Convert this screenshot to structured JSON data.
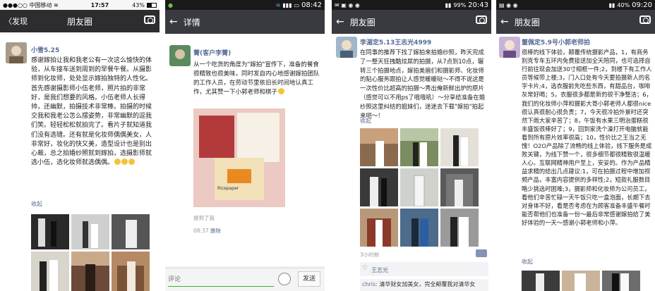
{
  "panels": {
    "p1": {
      "status": {
        "carrier": "中国移动",
        "time": "17:57",
        "battery": "43%"
      },
      "back": "发现",
      "title": "朋友圈",
      "name": "小雪5.25",
      "text": "感谢嫁拍让我和我老公有一次这么愉快的体验，从车接车送到周到的早餐午餐。从摄影师到化妆师，处处显示嫁拍独特的人性化。首先感谢摄影师小伍老师，照片拍的非常好，是我们想要的风格。小伍老师人长得帅，还幽默，拍摄技术非常棒。拍摄的时候交我和我老公怎么摆姿势，非常幽默的逗我们笑。轻轻松松就拍完了。看片子就知道我们没有选错。还有就是化妆师偶偶美女，人非常好，妆化的快又美，造型设计也是别出心裁，总之拍婚纱照就到嫁拍，选摄影师就选小伍，选化妆师就选偶偶。",
      "collapse": "收起"
    },
    "p2": {
      "status": {
        "time": "08:42"
      },
      "title": "详情",
      "name": "菁(客户李菁)",
      "text": "从一个吃货的角度为\"嫁拍\"宣传下，准备的餐食很精致也很美味，同时发自内心地感谢嫁拍团队的工作人员，在劳动节里依旧长时间地认真工作，尤其赞一下小郭老师和棋子",
      "photo_caption": "Ricepaper",
      "mention": "提到了我",
      "time": "08:37",
      "delete": "删除",
      "comment_placeholder": "评论",
      "send": "发送"
    },
    "p3": {
      "status": {
        "battery": "99%",
        "time": "20:43"
      },
      "title": "朋友圈",
      "name": "李湄定5.13王志光4999",
      "text": "在同事的推荐下找了嫁拍来拍婚纱照，昨天完成了一整天狂拽酷炫屌的拍摄，从7点到10点，辗转三个拍摄地点，嫁拍美眉们和摄影师、化妆师的贴心服务跟拍让人感觉暖暖哒～不得不说这是一次性价比超高的拍摄～秀出俺新鲜出炉的原片（感觉可以不用ps了哦哦吼）～分享给准备在婚纱照这里纠结的姐妹们，迷迷去下载\"嫁拍\"拍起来吧～！",
      "collapse": "收起",
      "ago": "3小时前",
      "like_name": "王志光",
      "comment_name": "chris:",
      "comment_text": "清华财女加美女，完全颠覆我对清华女"
    },
    "p4": {
      "status": {
        "battery": "40%",
        "time": "09:20"
      },
      "title": "朋友圈",
      "name": "董佩定5.9号小郭老师拍",
      "text": "很棒的线下体验，颠覆传统摄影产品，1，有商务别克专车五环内免费接送加全天陪同，也可选择自行前往现会加送30寸相框一件;2，到楼下有工作人员等候带上楼;3，门入口处有今天要拍摄新人的名字卡片;4，选衣服前先吃些东西，有甜品台，咖啡灰常好喝；5，衣服很多都是新的很干净整洁；6，我们的化妆师小萍和摄影大哥小郭老师人都很nice很认真很耐心很负责；7，今天很冷拍外景时还突然下雨大家辛苦了；8，午饭有水果三明治蛋糕很丰盛饭很棒好了；9，回到家洗个澡打开电脑就能看到所有原片效率很高；10，性价比之王当之无愧！O2O产品除了流畅的线上体验，线下服务是成败关键，为线下赞一个，很多细节都很精致很温暖人心。互联网精神用户至上，安妥的。作为产品精益求精的给出几点建议:1，可在拍摄过程中增加视频产品，丰富内容提供的多样性;2，短款礼服数目略少挑选时困难;3，摄影师和化妆师为公司员工，看他们辛苦忙碌一天午饭只吃一盒泡面，长期下去对身体不好，看是否考虑在为顾客准备丰盛午餐时能否帮他们也准备一份～最后非常感谢嫁拍给了美好体验的一天～感谢小郭老师和小萍。",
      "collapse": "收起"
    }
  },
  "colors": {
    "link": "#576b95",
    "titlebar": "#393a3f",
    "statusbar": "#1a1a1a"
  }
}
